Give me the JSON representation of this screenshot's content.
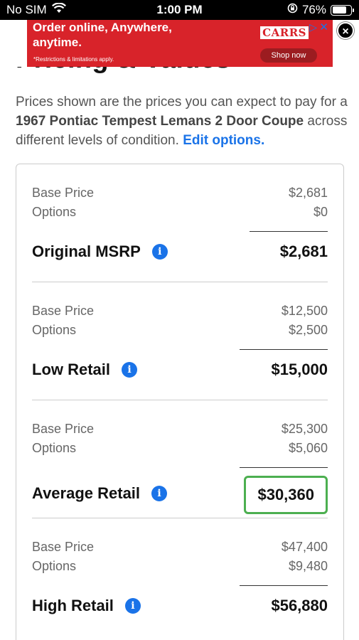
{
  "status_bar": {
    "carrier": "No SIM",
    "time": "1:00 PM",
    "battery": "76%"
  },
  "ad": {
    "headline": "Order online, Anywhere, anytime.",
    "fine_print": "*Restrictions & limitations apply.",
    "brand": "CARRS",
    "cta": "Shop now",
    "close": "×"
  },
  "page": {
    "title": "Pricing & Values",
    "intro_prefix": "Prices shown are the prices you can expect to pay for a",
    "vehicle": "1967 Pontiac Tempest Lemans 2 Door Coupe",
    "intro_suffix": "across different levels of condition.",
    "edit_link": "Edit options."
  },
  "pricing": [
    {
      "base_label": "Base Price",
      "base_value": "$2,681",
      "options_label": "Options",
      "options_value": "$0",
      "total_label": "Original MSRP",
      "total_value": "$2,681",
      "highlight": false
    },
    {
      "base_label": "Base Price",
      "base_value": "$12,500",
      "options_label": "Options",
      "options_value": "$2,500",
      "total_label": "Low Retail",
      "total_value": "$15,000",
      "highlight": false
    },
    {
      "base_label": "Base Price",
      "base_value": "$25,300",
      "options_label": "Options",
      "options_value": "$5,060",
      "total_label": "Average Retail",
      "total_value": "$30,360",
      "highlight": true
    },
    {
      "base_label": "Base Price",
      "base_value": "$47,400",
      "options_label": "Options",
      "options_value": "$9,480",
      "total_label": "High Retail",
      "total_value": "$56,880",
      "highlight": false
    }
  ],
  "colors": {
    "accent": "#1a73e8",
    "highlight_border": "#4caf50",
    "ad_red": "#d8232a"
  }
}
